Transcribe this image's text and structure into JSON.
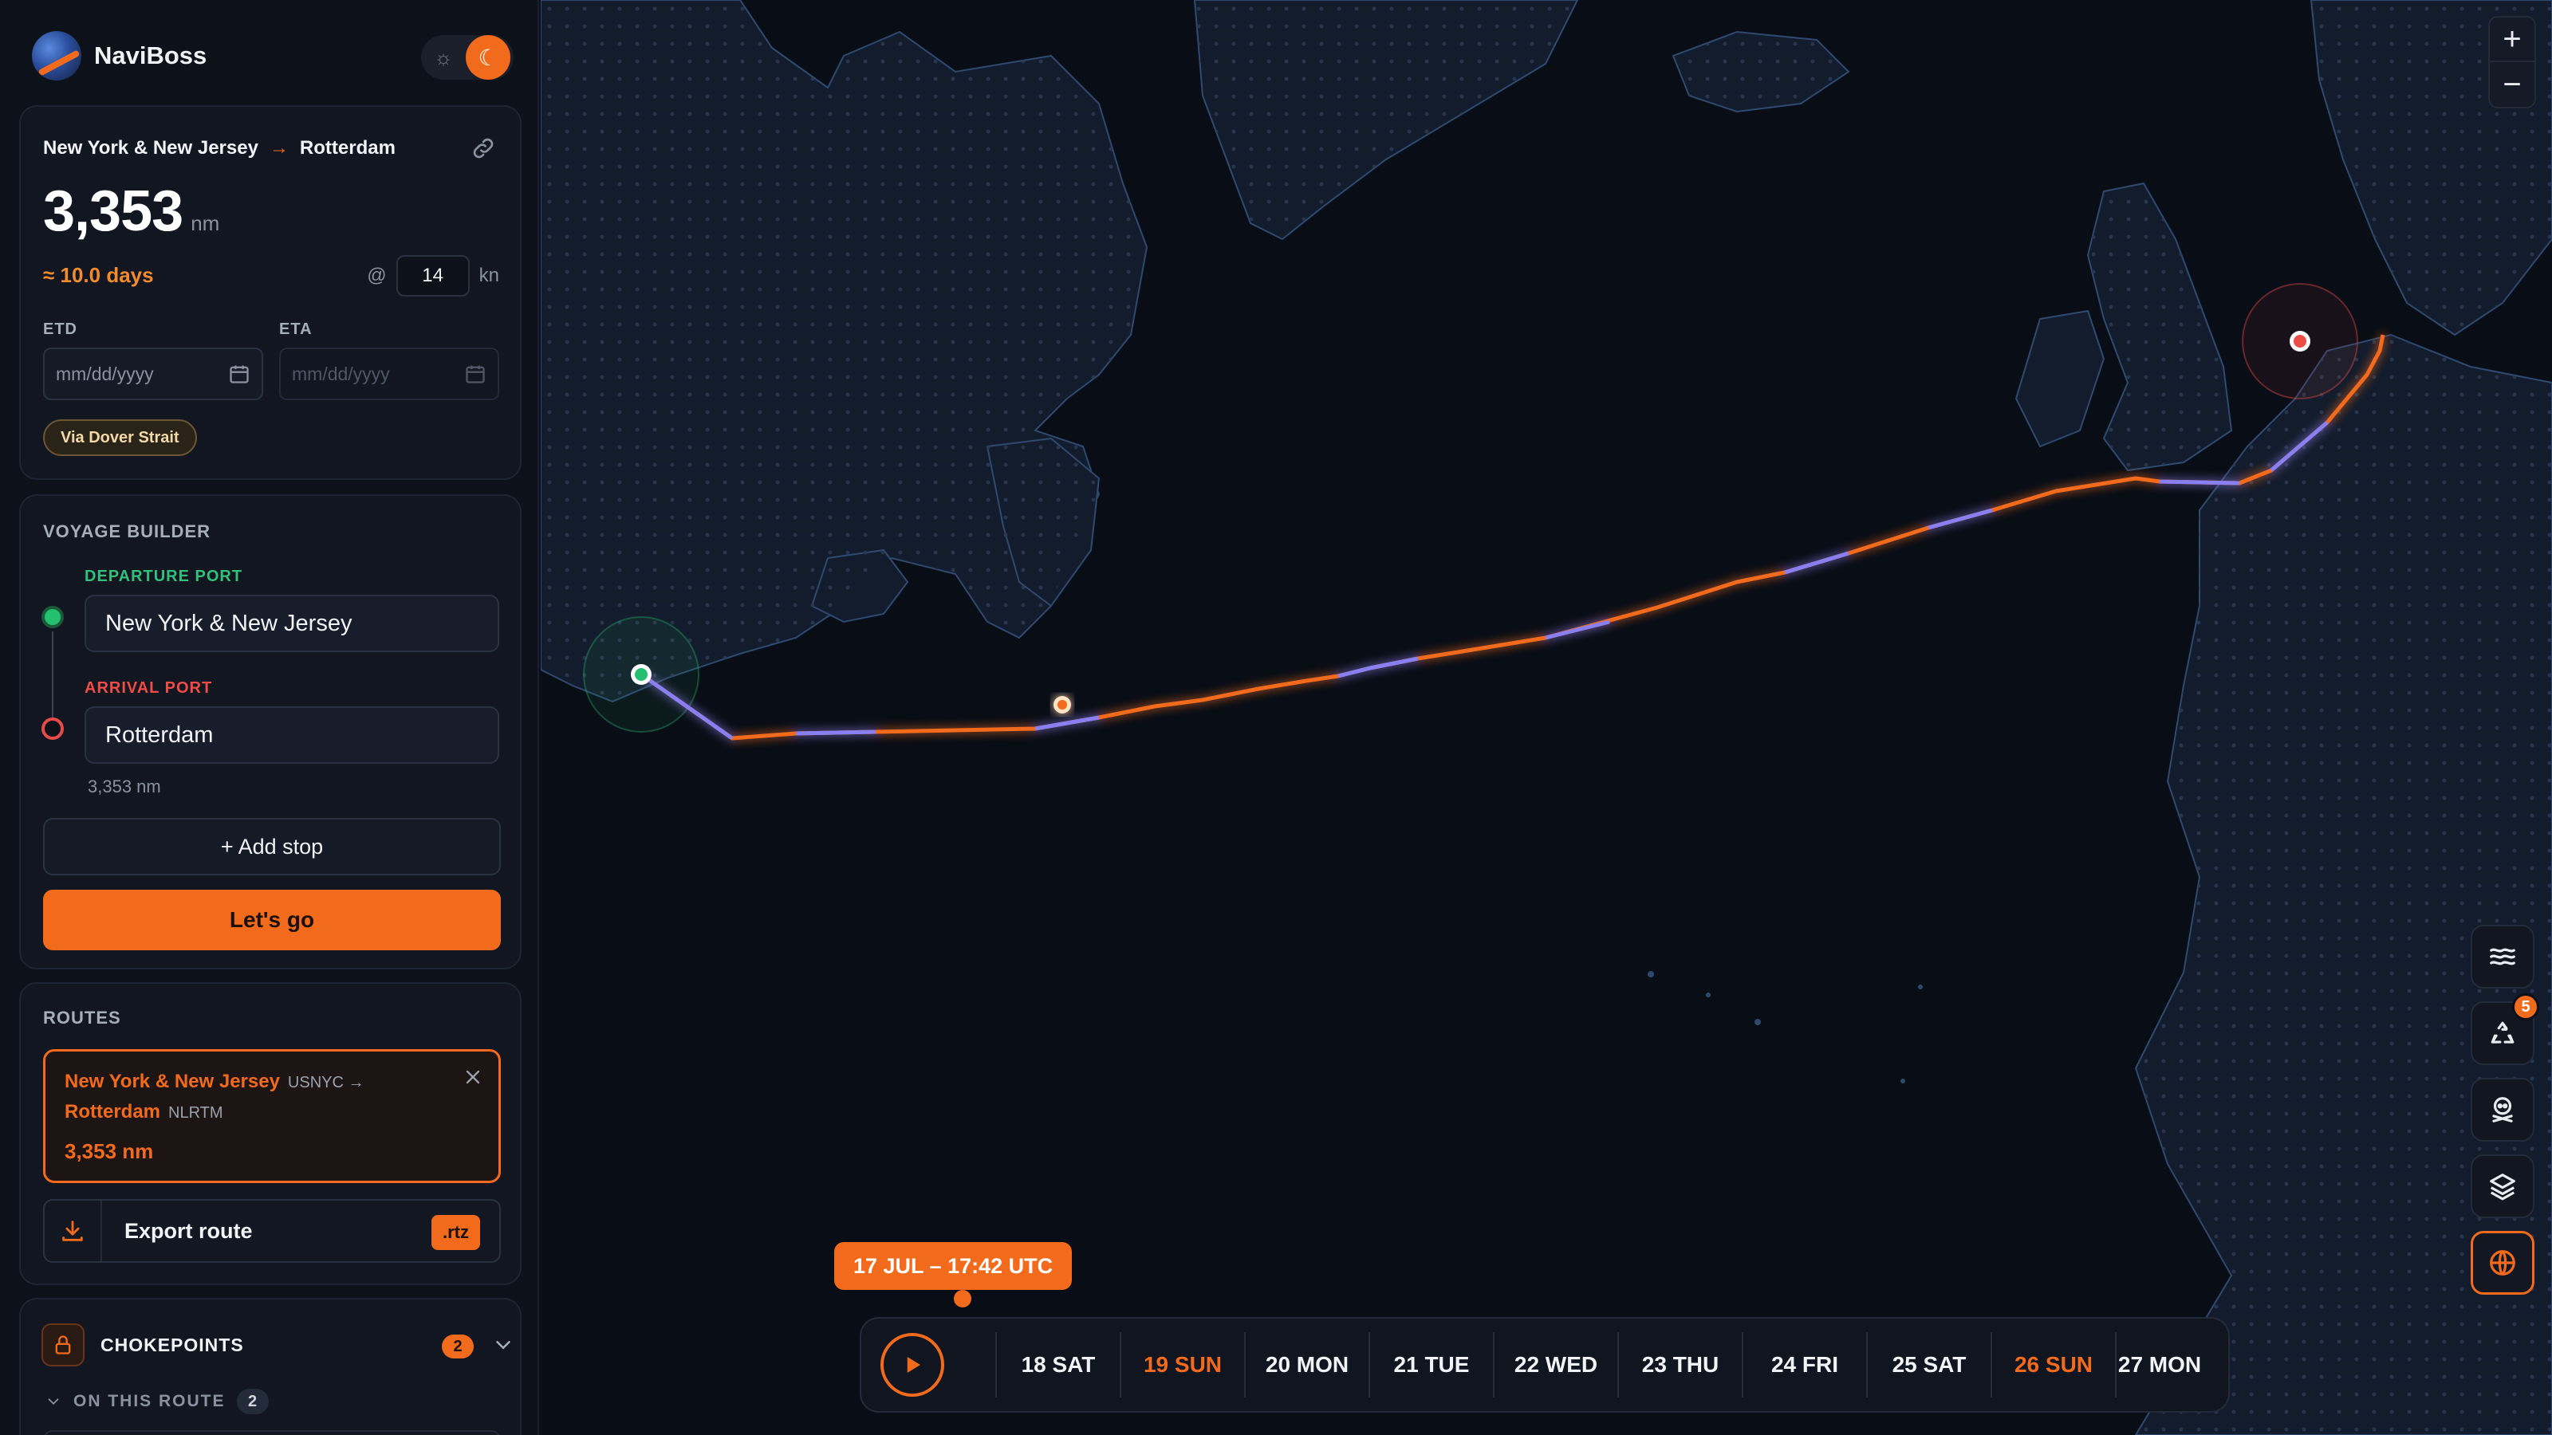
{
  "app": {
    "name": "NaviBoss"
  },
  "summary": {
    "from": "New York & New Jersey",
    "arrow": "→",
    "to": "Rotterdam",
    "distance": "3,353",
    "distance_unit": "nm",
    "duration": "≈ 10.0 days",
    "speed_prefix": "@",
    "speed": "14",
    "speed_unit": "kn",
    "etd_label": "ETD",
    "eta_label": "ETA",
    "etd_placeholder": "mm/dd/yyyy",
    "eta_placeholder": "mm/dd/yyyy",
    "via": "Via Dover Strait"
  },
  "builder": {
    "title": "VOYAGE BUILDER",
    "departure_label": "DEPARTURE PORT",
    "departure_value": "New York & New Jersey",
    "arrival_label": "ARRIVAL PORT",
    "arrival_value": "Rotterdam",
    "leg_distance": "3,353 nm",
    "add_stop": "+ Add stop",
    "go": "Let's go"
  },
  "routes": {
    "title": "ROUTES",
    "card": {
      "from_name": "New York & New Jersey",
      "from_code": "USNYC →",
      "to_name": "Rotterdam",
      "to_code": "NLRTM",
      "distance": "3,353 nm"
    },
    "export_label": "Export route",
    "export_format": ".rtz"
  },
  "chokepoints": {
    "title": "CHOKEPOINTS",
    "count": "2",
    "on_route_label": "ON THIS ROUTE",
    "on_route_count": "2"
  },
  "map": {
    "zoom_in": "+",
    "zoom_out": "−",
    "tool_badge": "5",
    "route_colors": {
      "primary": "#f26a1b",
      "secondary": "#8a7ff0"
    },
    "departure_color": "#24c06f",
    "arrival_color": "#ef4b47"
  },
  "timeline": {
    "current": "17 JUL – 17:42 UTC",
    "days": [
      {
        "label": "18 SAT",
        "weekend_sun": false
      },
      {
        "label": "19 SUN",
        "weekend_sun": true
      },
      {
        "label": "20 MON",
        "weekend_sun": false
      },
      {
        "label": "21 TUE",
        "weekend_sun": false
      },
      {
        "label": "22 WED",
        "weekend_sun": false
      },
      {
        "label": "23 THU",
        "weekend_sun": false
      },
      {
        "label": "24 FRI",
        "weekend_sun": false
      },
      {
        "label": "25 SAT",
        "weekend_sun": false
      },
      {
        "label": "26 SUN",
        "weekend_sun": true
      },
      {
        "label": "27 MON",
        "weekend_sun": false
      }
    ]
  }
}
